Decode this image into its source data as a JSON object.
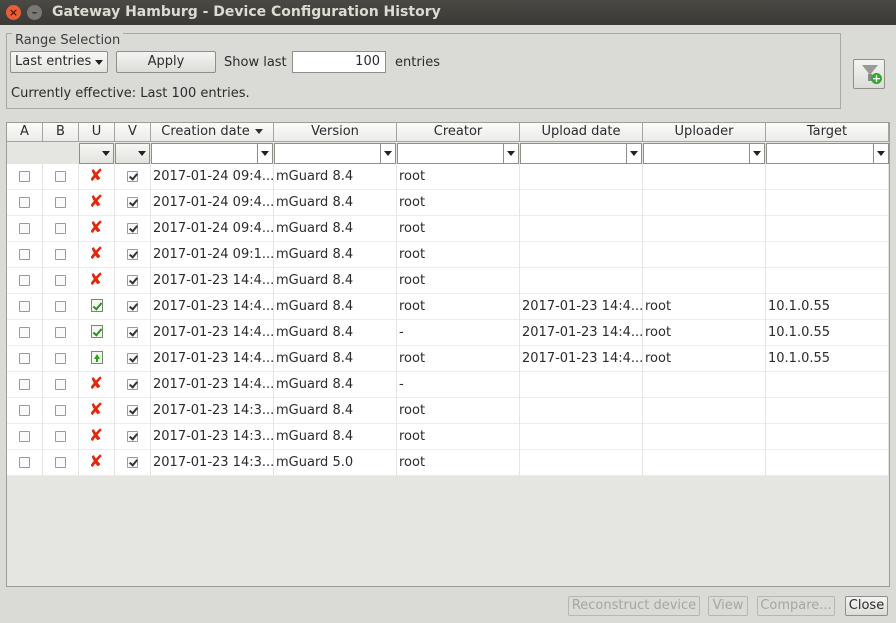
{
  "window": {
    "title": "Gateway Hamburg - Device Configuration History"
  },
  "range": {
    "legend": "Range Selection",
    "mode": "Last entries",
    "apply_label": "Apply",
    "show_last_label": "Show last",
    "count_value": "100",
    "entries_label": "entries",
    "effective_text": "Currently effective: Last 100 entries."
  },
  "icons": {
    "filter": "add-filter-icon",
    "rejected": "red-x-icon",
    "uploaded": "green-check-icon",
    "upload_pending": "upload-arrow-icon"
  },
  "colors": {
    "reject": "#e02a10",
    "ok": "#2f8f1f"
  },
  "table": {
    "columns": [
      "A",
      "B",
      "U",
      "V",
      "Creation date",
      "Version",
      "Creator",
      "Upload date",
      "Uploader",
      "Target"
    ],
    "rows": [
      {
        "a": false,
        "b": false,
        "u": "x",
        "v": true,
        "creation": "2017-01-24 09:4...",
        "version": "mGuard 8.4",
        "creator": "root",
        "upload": "",
        "uploader": "",
        "target": ""
      },
      {
        "a": false,
        "b": false,
        "u": "x",
        "v": true,
        "creation": "2017-01-24 09:4...",
        "version": "mGuard 8.4",
        "creator": "root",
        "upload": "",
        "uploader": "",
        "target": ""
      },
      {
        "a": false,
        "b": false,
        "u": "x",
        "v": true,
        "creation": "2017-01-24 09:4...",
        "version": "mGuard 8.4",
        "creator": "root",
        "upload": "",
        "uploader": "",
        "target": ""
      },
      {
        "a": false,
        "b": false,
        "u": "x",
        "v": true,
        "creation": "2017-01-24 09:1...",
        "version": "mGuard 8.4",
        "creator": "root",
        "upload": "",
        "uploader": "",
        "target": ""
      },
      {
        "a": false,
        "b": false,
        "u": "x",
        "v": true,
        "creation": "2017-01-23 14:4...",
        "version": "mGuard 8.4",
        "creator": "root",
        "upload": "",
        "uploader": "",
        "target": ""
      },
      {
        "a": false,
        "b": false,
        "u": "ok",
        "v": true,
        "creation": "2017-01-23 14:4...",
        "version": "mGuard 8.4",
        "creator": "root",
        "upload": "2017-01-23 14:4...",
        "uploader": "root",
        "target": "10.1.0.55"
      },
      {
        "a": false,
        "b": false,
        "u": "ok",
        "v": true,
        "creation": "2017-01-23 14:4...",
        "version": "mGuard 8.4",
        "creator": "-",
        "upload": "2017-01-23 14:4...",
        "uploader": "root",
        "target": "10.1.0.55"
      },
      {
        "a": false,
        "b": false,
        "u": "up",
        "v": true,
        "creation": "2017-01-23 14:4...",
        "version": "mGuard 8.4",
        "creator": "root",
        "upload": "2017-01-23 14:4...",
        "uploader": "root",
        "target": "10.1.0.55"
      },
      {
        "a": false,
        "b": false,
        "u": "x",
        "v": true,
        "creation": "2017-01-23 14:4...",
        "version": "mGuard 8.4",
        "creator": "-",
        "upload": "",
        "uploader": "",
        "target": ""
      },
      {
        "a": false,
        "b": false,
        "u": "x",
        "v": true,
        "creation": "2017-01-23 14:3...",
        "version": "mGuard 8.4",
        "creator": "root",
        "upload": "",
        "uploader": "",
        "target": ""
      },
      {
        "a": false,
        "b": false,
        "u": "x",
        "v": true,
        "creation": "2017-01-23 14:3...",
        "version": "mGuard 8.4",
        "creator": "root",
        "upload": "",
        "uploader": "",
        "target": ""
      },
      {
        "a": false,
        "b": false,
        "u": "x",
        "v": true,
        "creation": "2017-01-23 14:3...",
        "version": "mGuard 5.0",
        "creator": "root",
        "upload": "",
        "uploader": "",
        "target": ""
      }
    ]
  },
  "buttons": {
    "reconstruct": "Reconstruct device",
    "view": "View",
    "compare": "Compare...",
    "close": "Close"
  }
}
